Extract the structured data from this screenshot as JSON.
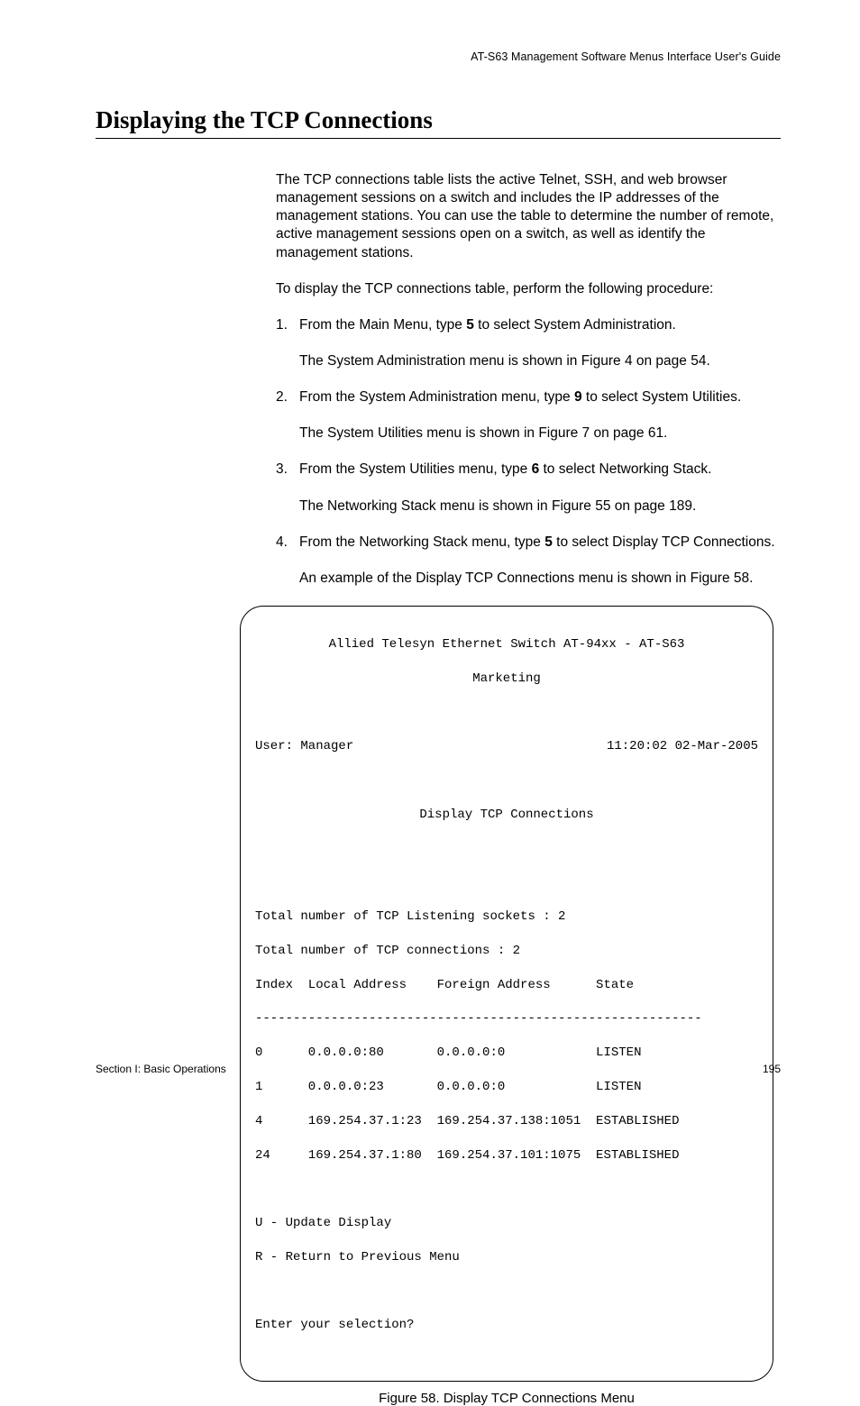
{
  "running_header": "AT-S63 Management Software Menus Interface User's Guide",
  "section_title": "Displaying the TCP Connections",
  "intro_para": "The TCP connections table lists the active Telnet, SSH, and web browser management sessions on a switch and includes the IP addresses of the management stations. You can use the table to determine the number of remote, active management sessions open on a switch, as well as identify the management stations.",
  "lead_in": "To display the TCP connections table, perform the following procedure:",
  "steps": [
    {
      "num": "1.",
      "pre": "From the Main Menu, type ",
      "bold": "5",
      "post": " to select System Administration.",
      "note": "The System Administration menu is shown in Figure 4 on page 54."
    },
    {
      "num": "2.",
      "pre": "From the System Administration menu, type ",
      "bold": "9",
      "post": " to select System Utilities.",
      "note": "The System Utilities menu is shown in Figure 7 on page 61."
    },
    {
      "num": "3.",
      "pre": "From the System Utilities menu, type ",
      "bold": "6",
      "post": " to select Networking Stack.",
      "note": "The Networking Stack menu is shown in Figure 55 on page 189."
    },
    {
      "num": "4.",
      "pre": "From the Networking Stack menu, type ",
      "bold": "5",
      "post": " to select Display TCP Connections.",
      "note": "An example of the Display TCP Connections menu is shown in Figure 58."
    }
  ],
  "terminal": {
    "title1": "Allied Telesyn Ethernet Switch AT-94xx - AT-S63",
    "title2": "Marketing",
    "user_label": "User: Manager",
    "timestamp": "11:20:02 02-Mar-2005",
    "screen_title": "Display TCP Connections",
    "summary1": "Total number of TCP Listening sockets : 2",
    "summary2": "Total number of TCP connections : 2",
    "header_row": "Index  Local Address    Foreign Address      State",
    "divider": "-----------------------------------------------------------",
    "rows": [
      "0      0.0.0.0:80       0.0.0.0:0            LISTEN",
      "1      0.0.0.0:23       0.0.0.0:0            LISTEN",
      "4      169.254.37.1:23  169.254.37.138:1051  ESTABLISHED",
      "24     169.254.37.1:80  169.254.37.101:1075  ESTABLISHED"
    ],
    "opt_u": "U - Update Display",
    "opt_r": "R - Return to Previous Menu",
    "prompt": "Enter your selection?"
  },
  "figure_caption": "Figure 58. Display TCP Connections Menu",
  "footer_left": "Section I: Basic Operations",
  "footer_right": "195"
}
